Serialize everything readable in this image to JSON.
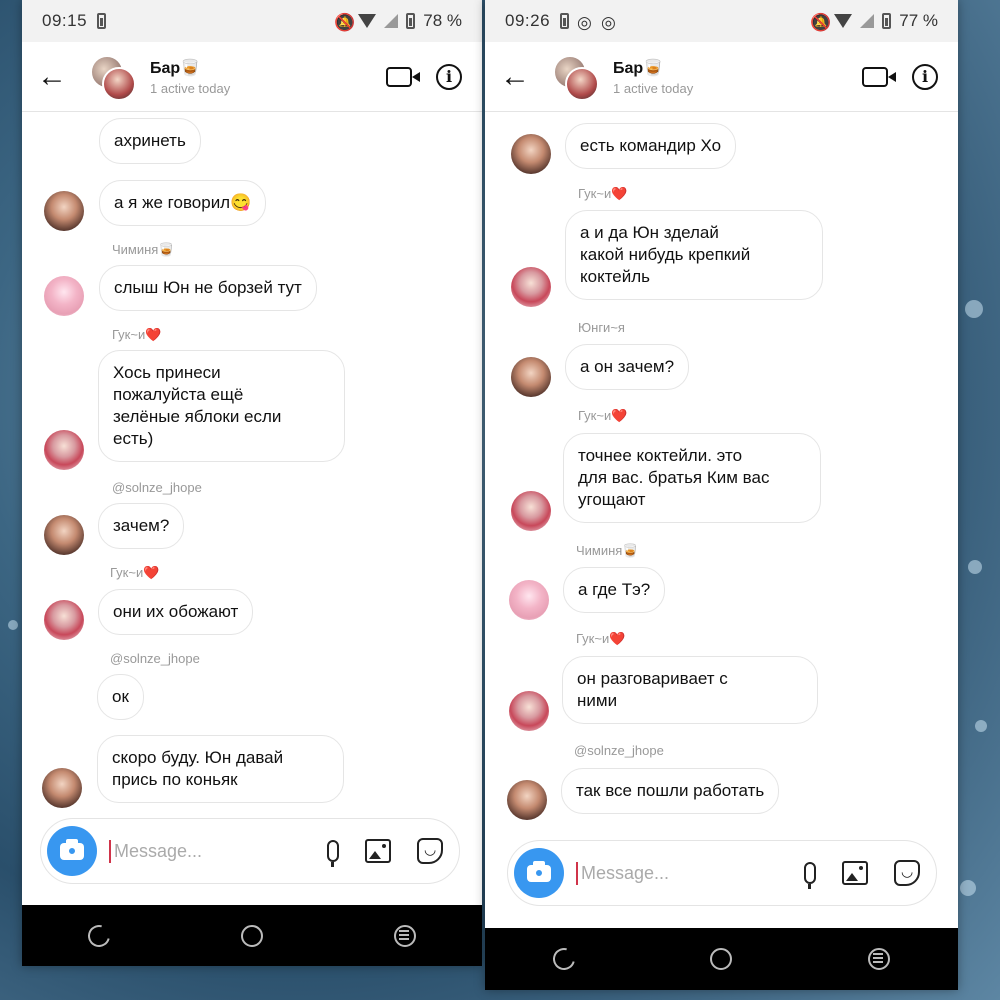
{
  "left": {
    "status": {
      "time": "09:15",
      "battery": "78 %"
    },
    "header": {
      "title": "Бар🥃",
      "subtitle": "1 active today"
    },
    "messages": [
      {
        "type": "bubble",
        "text": "ахринеть"
      },
      {
        "type": "bubble",
        "text": "а я же говорил😋"
      },
      {
        "type": "sender",
        "text": "Чиминя🥃"
      },
      {
        "type": "bubble",
        "text": "слыш Юн не борзей тут"
      },
      {
        "type": "sender",
        "text": "Гук~и❤️"
      },
      {
        "type": "bubble",
        "text": "Хось  принеси\nпожалуйста ещё\nзелёные яблоки если\nесть)"
      },
      {
        "type": "sender",
        "text": "@solnze_jhope"
      },
      {
        "type": "bubble",
        "text": "зачем?"
      },
      {
        "type": "sender",
        "text": "Гук~и❤️"
      },
      {
        "type": "bubble",
        "text": "они их обожают"
      },
      {
        "type": "sender",
        "text": "@solnze_jhope"
      },
      {
        "type": "bubble",
        "text": "ок"
      },
      {
        "type": "bubble",
        "text": "скоро буду. Юн давай\nпрись по коньяк"
      }
    ],
    "input_placeholder": "Message..."
  },
  "right": {
    "status": {
      "time": "09:26",
      "battery": "77 %"
    },
    "header": {
      "title": "Бар🥃",
      "subtitle": "1 active today"
    },
    "messages": [
      {
        "type": "bubble",
        "text": "есть командир Хо"
      },
      {
        "type": "sender",
        "text": "Гук~и❤️"
      },
      {
        "type": "bubble",
        "text": "а и да Юн зделай\nкакой нибудь крепкий\nкоктейль"
      },
      {
        "type": "sender",
        "text": "Юнги~я"
      },
      {
        "type": "bubble",
        "text": "а он зачем?"
      },
      {
        "type": "sender",
        "text": "Гук~и❤️"
      },
      {
        "type": "bubble",
        "text": "точнее коктейли. это\nдля вас. братья Ким вас\nугощают"
      },
      {
        "type": "sender",
        "text": "Чиминя🥃"
      },
      {
        "type": "bubble",
        "text": "а где Тэ?"
      },
      {
        "type": "sender",
        "text": "Гук~и❤️"
      },
      {
        "type": "bubble",
        "text": "он разговаривает с\nними"
      },
      {
        "type": "sender",
        "text": "@solnze_jhope"
      },
      {
        "type": "bubble",
        "text": "так все пошли работать"
      }
    ],
    "input_placeholder": "Message..."
  },
  "icons": [
    "back-arrow-icon",
    "video-call-icon",
    "info-icon",
    "camera-icon",
    "microphone-icon",
    "gallery-icon",
    "sticker-icon"
  ],
  "colors": {
    "accent": "#3897f0",
    "cursor": "#d0344a",
    "navbar": "#000000"
  }
}
